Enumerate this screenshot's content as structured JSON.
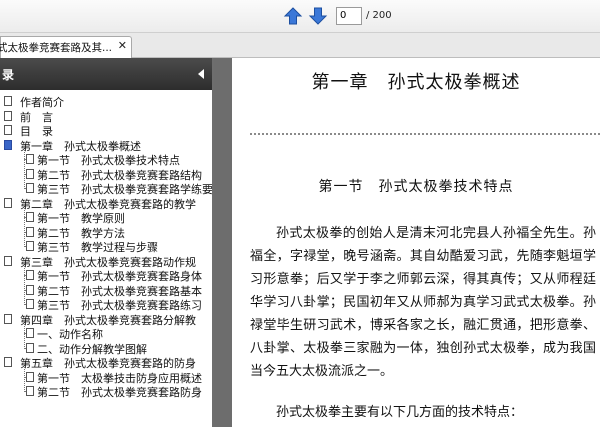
{
  "toolbar": {
    "page_current": "0",
    "page_total": "/ 200"
  },
  "tab": {
    "title": "式太极拳竞赛套路及其...",
    "close": "✕"
  },
  "sidebar": {
    "title": "录",
    "collapse": "◂",
    "items": [
      {
        "label": "作者简介"
      },
      {
        "label": "前　言"
      },
      {
        "label": "目　录"
      },
      {
        "label": "第一章　孙式太极拳概述"
      },
      {
        "label": "第一节　孙式太极拳技术特点"
      },
      {
        "label": "第二节　孙式太极拳竞赛套路结构"
      },
      {
        "label": "第三节　孙式太极拳竞赛套路学练要"
      },
      {
        "label": "第二章　孙式太极拳竞赛套路的教学"
      },
      {
        "label": "第一节　教学原则"
      },
      {
        "label": "第二节　教学方法"
      },
      {
        "label": "第三节　教学过程与步骤"
      },
      {
        "label": "第三章　孙式太极拳竞赛套路动作规"
      },
      {
        "label": "第一节　孙式太极拳竞赛套路身体"
      },
      {
        "label": "第二节　孙式太极拳竞赛套路基本"
      },
      {
        "label": "第三节　孙式太极拳竞赛套路练习"
      },
      {
        "label": "第四章　孙式太极拳竞赛套路分解教"
      },
      {
        "label": "一、动作名称"
      },
      {
        "label": "二、动作分解教学图解"
      },
      {
        "label": "第五章　孙式太极拳竞赛套路的防身"
      },
      {
        "label": "第一节　太极拳技击防身应用概述"
      },
      {
        "label": "第二节　孙式太极拳竞赛套路防身"
      }
    ]
  },
  "document": {
    "chapter_title": "第一章　孙式太极拳概述",
    "section_title": "第一节　孙式太极拳技术特点",
    "paragraph1": "孙式太极拳的创始人是清末河北完县人孙福全先生。孙福全，字禄堂，晚号涵斋。其自幼酷爱习武，先随李魁垣学习形意拳；后又学于李之师郭云深，得其真传；又从师程廷华学习八卦掌；民国初年又从师郝为真学习武式太极拳。孙禄堂毕生研习武术，博采各家之长，融汇贯通，把形意拳、八卦掌、太极拳三家融为一体，独创孙式太极拳，成为我国当今五大太极流派之一。",
    "paragraph2": "孙式太极拳主要有以下几方面的技术特点："
  },
  "colors": {
    "accent": "#3a66c8",
    "sidebar_header": "#3a3a3a",
    "gutter": "#6d6d6d"
  }
}
